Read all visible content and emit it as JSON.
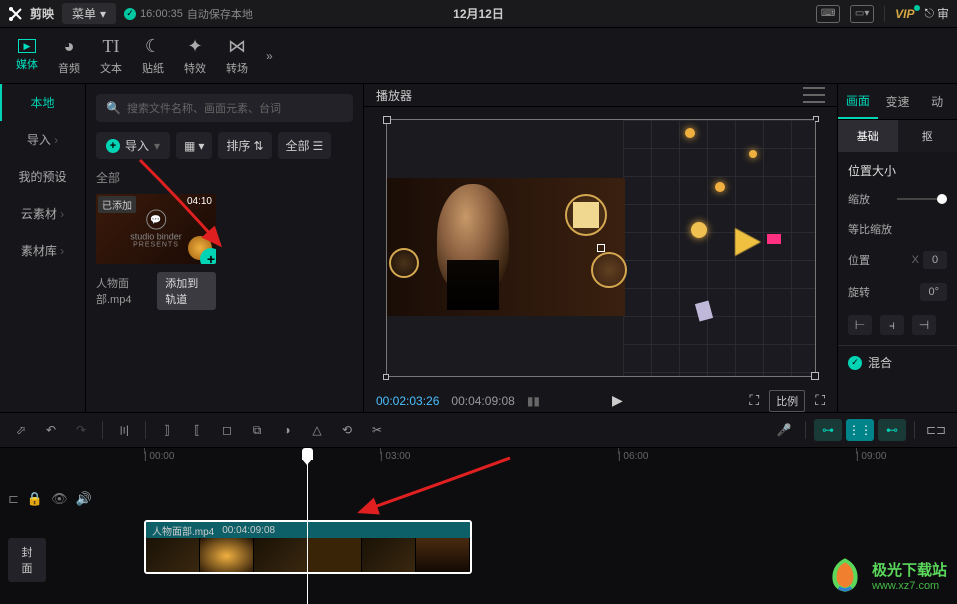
{
  "titlebar": {
    "app_name": "剪映",
    "menu_label": "菜单",
    "autosave_time": "16:00:35",
    "autosave_text": "自动保存本地",
    "project_title": "12月12日",
    "vip_label": "VIP",
    "review_label": "审"
  },
  "top_tabs": [
    {
      "label": "媒体",
      "icon": "▶"
    },
    {
      "label": "音频",
      "icon": "◕"
    },
    {
      "label": "文本",
      "icon": "T"
    },
    {
      "label": "贴纸",
      "icon": "☾"
    },
    {
      "label": "特效",
      "icon": "✦"
    },
    {
      "label": "转场",
      "icon": "⋈"
    }
  ],
  "sidebar": {
    "items": [
      "本地",
      "导入",
      "我的预设",
      "云素材",
      "素材库"
    ]
  },
  "media": {
    "search_placeholder": "搜索文件名称、画面元素、台词",
    "import_label": "导入",
    "sort_label": "排序",
    "all_label": "全部",
    "category_label": "全部",
    "item": {
      "badge": "已添加",
      "duration": "04:10",
      "logo_text": "studio binder",
      "logo_sub": "PRESENTS",
      "name": "人物面部.mp4",
      "tooltip": "添加到轨道"
    }
  },
  "preview": {
    "header_label": "播放器",
    "time_current": "00:02:03:26",
    "time_total": "00:04:09:08",
    "ratio_label": "比例"
  },
  "props": {
    "tabs": [
      "画面",
      "变速",
      "动"
    ],
    "subtabs": [
      "基础",
      "抠"
    ],
    "section_title": "位置大小",
    "scale_label": "缩放",
    "equal_scale_label": "等比缩放",
    "position_label": "位置",
    "position_x": "0",
    "rotation_label": "旋转",
    "rotation_val": "0°",
    "blend_label": "混合"
  },
  "timeline": {
    "ticks": [
      "00:00",
      "03:00",
      "06:00",
      "09:00"
    ],
    "cover_label": "封面",
    "clip": {
      "name": "人物面部.mp4",
      "duration": "00:04:09:08"
    }
  },
  "watermark": {
    "title": "极光下载站",
    "sub": "www.xz7.com"
  }
}
